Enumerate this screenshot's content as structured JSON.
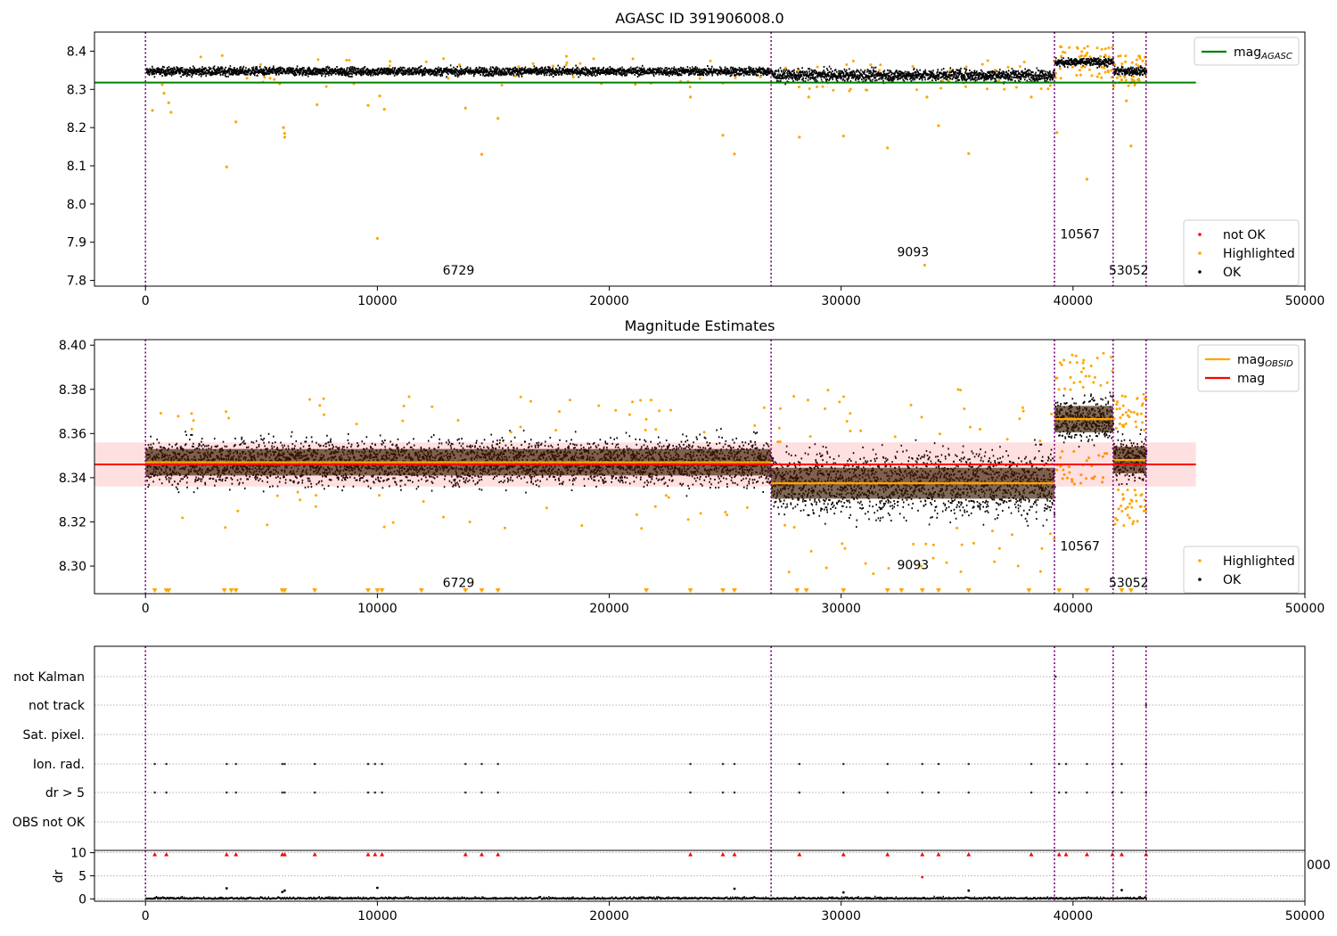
{
  "chart_data": [
    {
      "type": "scatter",
      "title": "AGASC ID 391906008.0",
      "xlim": [
        -2200,
        50000
      ],
      "ylim": [
        7.785,
        8.45
      ],
      "xticks": [
        0,
        10000,
        20000,
        30000,
        40000,
        50000
      ],
      "yticks": [
        7.8,
        7.9,
        8.0,
        8.1,
        8.2,
        8.3,
        8.4
      ],
      "ytick_labels": [
        "7.8",
        "7.9",
        "8.0",
        "8.1",
        "8.2",
        "8.3",
        "8.4"
      ],
      "legend_upper": {
        "position": "top-right",
        "entries": [
          {
            "label": "mag",
            "sub": "AGASC",
            "color": "#008000"
          }
        ]
      },
      "legend_lower": {
        "position": "bottom-right",
        "entries": [
          {
            "label": "not OK",
            "color": "#ff0000"
          },
          {
            "label": "Highlighted",
            "color": "#ffa500"
          },
          {
            "label": "OK",
            "color": "#000000"
          }
        ]
      },
      "hline": {
        "label": "mag_AGASC",
        "y": 8.318,
        "x_range": [
          -2200,
          45300
        ],
        "color": "#008000"
      },
      "obs_boundaries": [
        0,
        26980,
        39200,
        41730,
        43150
      ],
      "obs_labels": [
        {
          "text": "6729",
          "x": 13500,
          "y": 7.815
        },
        {
          "text": "9093",
          "x": 33100,
          "y": 7.863
        },
        {
          "text": "10567",
          "x": 40300,
          "y": 7.91
        },
        {
          "text": "53052",
          "x": 42400,
          "y": 7.815
        }
      ],
      "segments": [
        {
          "x_range": [
            0,
            26980
          ],
          "mean": 8.347,
          "spread": 0.012
        },
        {
          "x_range": [
            26980,
            39200
          ],
          "mean": 8.337,
          "spread": 0.017
        },
        {
          "x_range": [
            39200,
            41730
          ],
          "mean": 8.371,
          "spread": 0.012
        },
        {
          "x_range": [
            41730,
            43150
          ],
          "mean": 8.348,
          "spread": 0.012
        }
      ],
      "highlighted_outliers": [
        {
          "x": 300,
          "y": 8.245
        },
        {
          "x": 800,
          "y": 8.29
        },
        {
          "x": 1000,
          "y": 8.265
        },
        {
          "x": 1100,
          "y": 8.24
        },
        {
          "x": 3500,
          "y": 8.097
        },
        {
          "x": 3900,
          "y": 8.215
        },
        {
          "x": 5950,
          "y": 8.2
        },
        {
          "x": 6000,
          "y": 8.185
        },
        {
          "x": 6000,
          "y": 8.175
        },
        {
          "x": 7400,
          "y": 8.26
        },
        {
          "x": 9600,
          "y": 8.258
        },
        {
          "x": 10000,
          "y": 7.91
        },
        {
          "x": 10100,
          "y": 8.283
        },
        {
          "x": 10300,
          "y": 8.248
        },
        {
          "x": 13800,
          "y": 8.251
        },
        {
          "x": 14500,
          "y": 8.13
        },
        {
          "x": 15200,
          "y": 8.224
        },
        {
          "x": 23500,
          "y": 8.28
        },
        {
          "x": 24900,
          "y": 8.18
        },
        {
          "x": 25400,
          "y": 8.131
        },
        {
          "x": 28200,
          "y": 8.175
        },
        {
          "x": 28600,
          "y": 8.28
        },
        {
          "x": 30100,
          "y": 8.178
        },
        {
          "x": 32000,
          "y": 8.147
        },
        {
          "x": 33600,
          "y": 7.84
        },
        {
          "x": 33700,
          "y": 8.28
        },
        {
          "x": 34200,
          "y": 8.205
        },
        {
          "x": 35500,
          "y": 8.132
        },
        {
          "x": 38200,
          "y": 8.28
        },
        {
          "x": 39300,
          "y": 8.187
        },
        {
          "x": 40600,
          "y": 8.065
        },
        {
          "x": 42300,
          "y": 8.27
        },
        {
          "x": 42500,
          "y": 8.152
        },
        {
          "x": 42100,
          "y": 8.325
        }
      ]
    },
    {
      "type": "scatter",
      "title": "Magnitude Estimates",
      "xlim": [
        -2200,
        50000
      ],
      "ylim": [
        8.2875,
        8.4025
      ],
      "xticks": [
        0,
        10000,
        20000,
        30000,
        40000,
        50000
      ],
      "yticks": [
        8.3,
        8.32,
        8.34,
        8.36,
        8.38,
        8.4
      ],
      "ytick_labels": [
        "8.30",
        "8.32",
        "8.34",
        "8.36",
        "8.38",
        "8.40"
      ],
      "legend_upper": {
        "position": "top-right",
        "entries": [
          {
            "label": "mag",
            "sub": "OBSID",
            "color": "#ffa500"
          },
          {
            "label": "mag",
            "color": "#ff0000"
          }
        ]
      },
      "legend_lower": {
        "position": "bottom-right",
        "entries": [
          {
            "label": "Highlighted",
            "color": "#ffa500"
          },
          {
            "label": "OK",
            "color": "#000000"
          }
        ]
      },
      "mag_line": {
        "y": 8.346,
        "band": [
          8.336,
          8.356
        ],
        "x_range": [
          -2200,
          45300
        ],
        "color": "#ff0000"
      },
      "obs_boundaries": [
        0,
        26980,
        39200,
        41730,
        43150
      ],
      "obs_labels": [
        {
          "text": "6729",
          "x": 13500,
          "y": 8.2905
        },
        {
          "text": "9093",
          "x": 33100,
          "y": 8.2985
        },
        {
          "text": "10567",
          "x": 40300,
          "y": 8.307
        },
        {
          "text": "53052",
          "x": 42400,
          "y": 8.2905
        }
      ],
      "obs_mags": [
        {
          "x_range": [
            0,
            26980
          ],
          "mag": 8.347,
          "spread": 0.006,
          "scatter": 0.012
        },
        {
          "x_range": [
            26980,
            39200
          ],
          "mag": 8.3375,
          "spread": 0.007,
          "scatter": 0.017
        },
        {
          "x_range": [
            39200,
            41730
          ],
          "mag": 8.3665,
          "spread": 0.006,
          "scatter": 0.012
        },
        {
          "x_range": [
            41730,
            43150
          ],
          "mag": 8.348,
          "spread": 0.006,
          "scatter": 0.012
        }
      ],
      "clipped_x": [
        400,
        900,
        1000,
        3400,
        3700,
        3900,
        5900,
        6000,
        7300,
        9600,
        10000,
        10200,
        11900,
        13800,
        14500,
        15200,
        21600,
        23500,
        24900,
        25400,
        28100,
        28500,
        30100,
        32000,
        32600,
        33500,
        34200,
        35500,
        38100,
        39400,
        40600,
        42100,
        42500
      ]
    },
    {
      "type": "scatter",
      "title": "",
      "xlim": [
        -2200,
        50000
      ],
      "flag_labels": [
        "not Kalman",
        "not track",
        "Sat. pixel.",
        "Ion. rad.",
        "dr > 5",
        "OBS not OK"
      ],
      "obs_boundaries": [
        0,
        26980,
        39200,
        41730,
        43150
      ],
      "flag_events": {
        "Ion. rad.": [
          400,
          900,
          3500,
          3900,
          5900,
          6000,
          7300,
          9600,
          9900,
          10200,
          13800,
          14500,
          15200,
          23500,
          24900,
          25400,
          28200,
          30100,
          32000,
          33500,
          34200,
          35500,
          38200,
          39400,
          39700,
          40600,
          41700,
          42100,
          43150
        ],
        "dr > 5": [
          400,
          900,
          3500,
          3900,
          5900,
          6000,
          7300,
          9600,
          9900,
          10200,
          13800,
          14500,
          15200,
          23500,
          24900,
          25400,
          28200,
          30100,
          32000,
          33500,
          34200,
          35500,
          38200,
          39400,
          39700,
          40600,
          41700,
          42100,
          43150
        ],
        "not Kalman": [
          39250
        ],
        "not track": [
          43150
        ]
      },
      "dr_panel": {
        "ylabel": "dr",
        "ylim": [
          -0.5,
          10.3
        ],
        "yticks": [
          0,
          5,
          10
        ],
        "ytick_labels": [
          "0",
          "5",
          "10"
        ],
        "clipped_x": [
          400,
          900,
          3500,
          3900,
          5900,
          6000,
          7300,
          9600,
          9900,
          10200,
          13800,
          14500,
          15200,
          23500,
          24900,
          25400,
          28200,
          30100,
          32000,
          33500,
          34200,
          35500,
          38200,
          39400,
          39700,
          40600,
          41700,
          42100,
          43150
        ],
        "spikes": [
          {
            "x": 3500,
            "y": 2.3
          },
          {
            "x": 5900,
            "y": 1.5
          },
          {
            "x": 6000,
            "y": 1.8
          },
          {
            "x": 10000,
            "y": 2.4
          },
          {
            "x": 25400,
            "y": 2.2
          },
          {
            "x": 30100,
            "y": 1.4
          },
          {
            "x": 33500,
            "y": 4.7
          },
          {
            "x": 35500,
            "y": 1.8
          },
          {
            "x": 42100,
            "y": 1.9
          }
        ]
      },
      "stray_tick": "000"
    }
  ],
  "xtick_labels": [
    "0",
    "10000",
    "20000",
    "30000",
    "40000",
    "50000"
  ]
}
